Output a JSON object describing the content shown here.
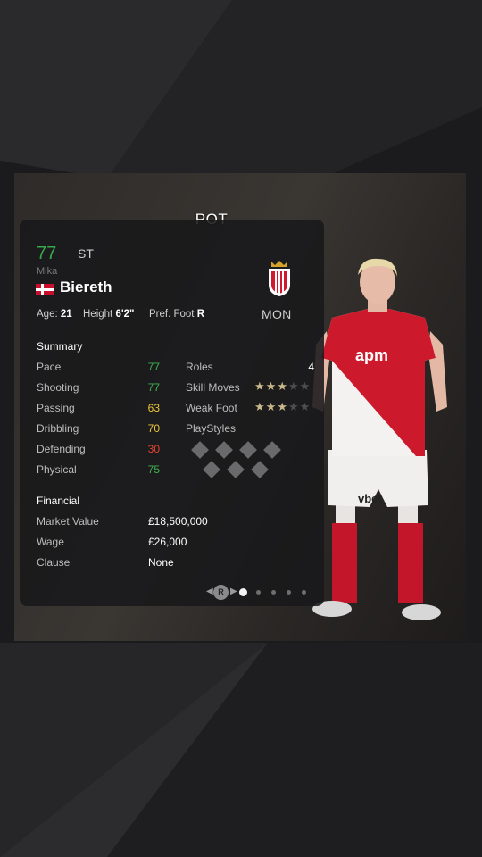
{
  "header": {
    "pot_label": "POT"
  },
  "player": {
    "overall": "77",
    "position": "ST",
    "first_name": "Mika",
    "last_name": "Biereth",
    "nation_flag": "denmark-flag",
    "club_short": "MON",
    "age_label": "Age:",
    "age": "21",
    "height_label": "Height",
    "height": "6'2\"",
    "foot_label": "Pref. Foot",
    "foot": "R"
  },
  "summary": {
    "title": "Summary",
    "stats": [
      {
        "label": "Pace",
        "value": "77",
        "color": "#3fb24f"
      },
      {
        "label": "Shooting",
        "value": "77",
        "color": "#3fb24f"
      },
      {
        "label": "Passing",
        "value": "63",
        "color": "#e8c53a"
      },
      {
        "label": "Dribbling",
        "value": "70",
        "color": "#e8c53a"
      },
      {
        "label": "Defending",
        "value": "30",
        "color": "#e0442f"
      },
      {
        "label": "Physical",
        "value": "75",
        "color": "#3fb24f"
      }
    ],
    "roles_label": "Roles",
    "roles_value": "4",
    "skill_moves_label": "Skill Moves",
    "skill_moves_stars": 3,
    "weak_foot_label": "Weak Foot",
    "weak_foot_stars": 3,
    "playstyles_label": "PlayStyles"
  },
  "financial": {
    "title": "Financial",
    "market_value_label": "Market Value",
    "market_value": "£18,500,000",
    "wage_label": "Wage",
    "wage": "£26,000",
    "clause_label": "Clause",
    "clause": "None"
  },
  "pager": {
    "button_label": "R",
    "pages": 5,
    "active": 0
  }
}
